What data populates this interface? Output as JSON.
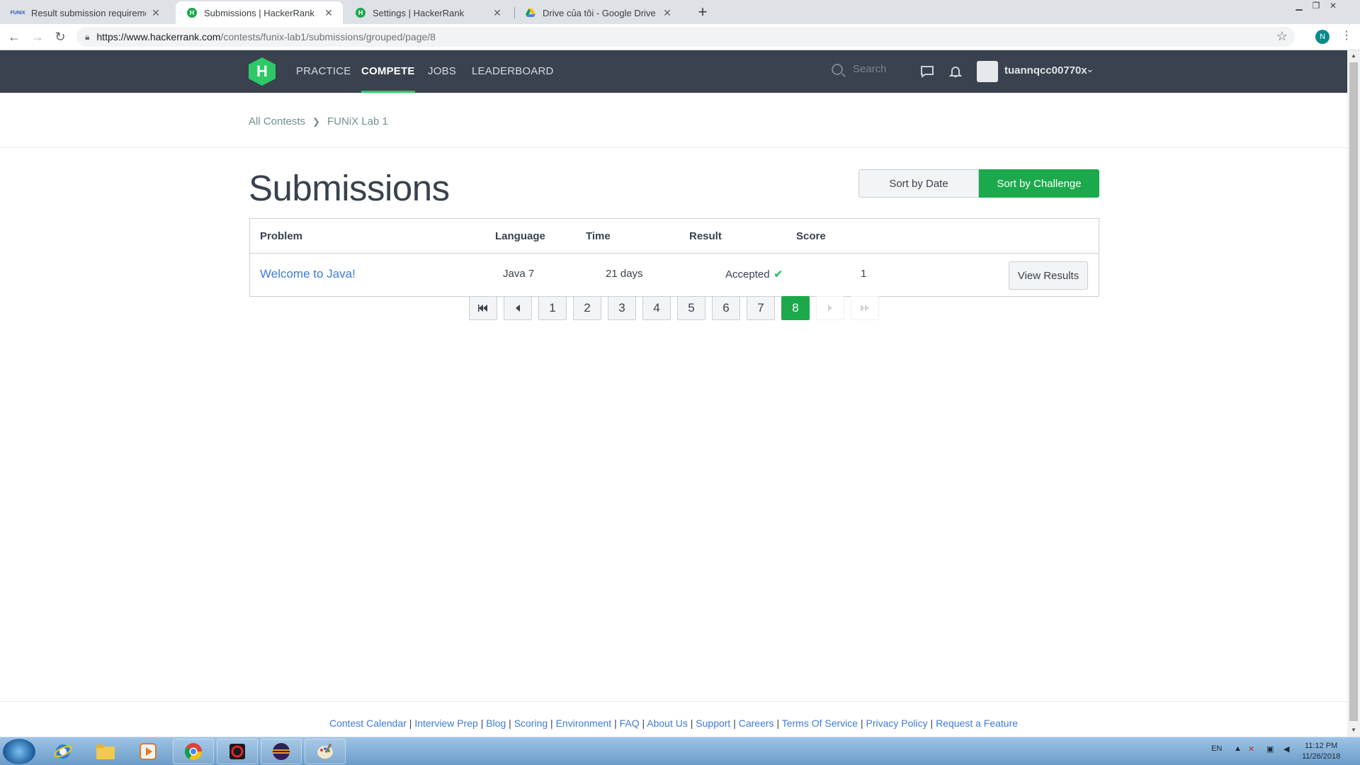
{
  "browser": {
    "tabs": [
      {
        "title": "Result submission requirement |",
        "active": false
      },
      {
        "title": "Submissions | HackerRank",
        "active": true
      },
      {
        "title": "Settings | HackerRank",
        "active": false
      },
      {
        "title": "Drive của tôi - Google Drive",
        "active": false
      }
    ],
    "funix_favicon": "FUNiX",
    "url_host": "https://www.hackerrank.com",
    "url_path": "/contests/funix-lab1/submissions/grouped/page/8",
    "profile_initial": "N"
  },
  "nav": {
    "logo": "H",
    "items": [
      "PRACTICE",
      "COMPETE",
      "JOBS",
      "LEADERBOARD"
    ],
    "active_item": "COMPETE",
    "search_placeholder": "Search",
    "username": "tuannqcc00770x"
  },
  "breadcrumb": [
    "All Contests",
    "FUNiX Lab 1"
  ],
  "page": {
    "title": "Submissions",
    "sort_by_date": "Sort by Date",
    "sort_by_challenge": "Sort by Challenge",
    "active_sort": "Sort by Challenge"
  },
  "table": {
    "headers": [
      "Problem",
      "Language",
      "Time",
      "Result",
      "Score"
    ],
    "rows": [
      {
        "problem": "Welcome to Java!",
        "language": "Java 7",
        "time": "21 days",
        "result": "Accepted",
        "score": "1",
        "action": "View Results"
      }
    ]
  },
  "pagination": {
    "pages": [
      "1",
      "2",
      "3",
      "4",
      "5",
      "6",
      "7",
      "8"
    ],
    "current": "8"
  },
  "footer": {
    "links": [
      "Contest Calendar",
      "Interview Prep",
      "Blog",
      "Scoring",
      "Environment",
      "FAQ",
      "About Us",
      "Support",
      "Careers",
      "Terms Of Service",
      "Privacy Policy",
      "Request a Feature"
    ],
    "separator": "|"
  },
  "taskbar": {
    "language": "EN",
    "time": "11:12 PM",
    "date": "11/26/2018"
  },
  "colors": {
    "nav_bg": "#39424e",
    "accent_green": "#1ba94c",
    "link_blue": "#3d7bd9"
  }
}
